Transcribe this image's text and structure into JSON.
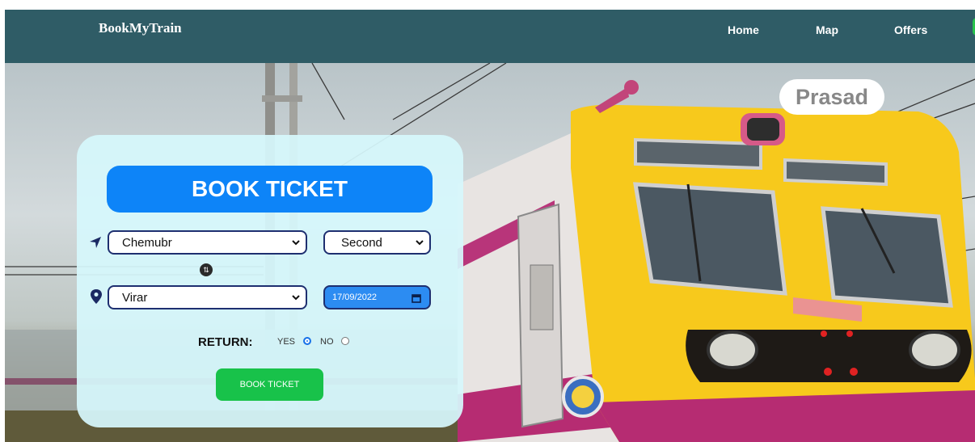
{
  "header": {
    "brand": "BookMyTrain",
    "nav": [
      {
        "label": "Home"
      },
      {
        "label": "Map"
      },
      {
        "label": "Offers"
      }
    ]
  },
  "user": {
    "name": "Prasad"
  },
  "booking": {
    "title": "BOOK TICKET",
    "from_station": "Chemubr",
    "travel_class": "Second",
    "to_station": "Virar",
    "date": "17/09/2022",
    "return_label": "RETURN:",
    "return_options": [
      {
        "label": "YES",
        "checked": true
      },
      {
        "label": "NO",
        "checked": false
      }
    ],
    "submit_label": "BOOK TICKET"
  },
  "colors": {
    "navbar": "#2f5c66",
    "card": "#d6f7fc",
    "title_button": "#0d84f8",
    "submit_button": "#18c24a",
    "date_field": "#2c8cf2"
  },
  "icons": {
    "from": "location-arrow-icon",
    "to": "map-pin-icon",
    "swap": "swap-icon",
    "calendar": "calendar-icon"
  }
}
